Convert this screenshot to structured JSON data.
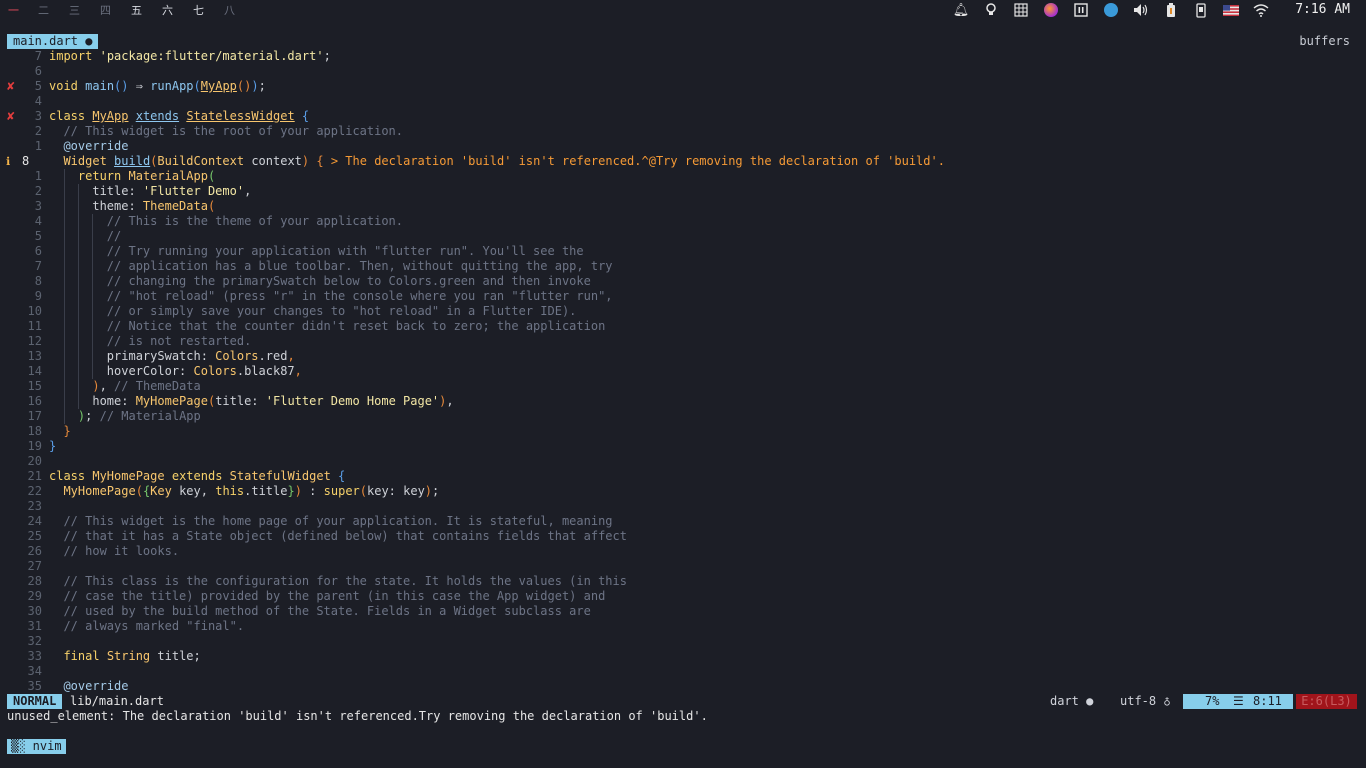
{
  "topbar": {
    "workspaces": [
      "一",
      "二",
      "三",
      "四",
      "五",
      "六",
      "七",
      "八"
    ],
    "clock": "7:16 AM",
    "tray_icons": [
      "bell-icon",
      "lightbulb-icon",
      "grid-icon",
      "firefox-icon",
      "pause-icon",
      "telegram-icon",
      "volume-icon",
      "battery-icon",
      "phone-icon",
      "us-flag-icon",
      "wifi-icon"
    ]
  },
  "tabline": {
    "active_tab": "main.dart ●",
    "right_label": "buffers"
  },
  "editor": {
    "lines": [
      {
        "ln": "7",
        "sign": "",
        "html": "<span class='kw'>import</span> <span class='str'>'package:flutter/material.dart'</span>;"
      },
      {
        "ln": "6",
        "sign": "",
        "html": ""
      },
      {
        "ln": "5",
        "sign": "err",
        "html": "<span class='kw'>void</span> <span class='fn'>main</span><span class='par1'>()</span> ⇒ <span class='fn'>runApp</span><span class='par1'>(</span><span class='cls ul'>MyApp</span><span class='par2'>()</span><span class='par1'>)</span>;"
      },
      {
        "ln": "4",
        "sign": "",
        "html": ""
      },
      {
        "ln": "3",
        "sign": "err",
        "html": "<span class='kw'>class</span> <span class='cls ul'>MyApp</span> <span class='fn ul'>xtends</span> <span class='cls ul'>StatelessWidget</span> <span class='par1'>{</span>"
      },
      {
        "ln": "2",
        "sign": "",
        "html": "  <span class='cmt'>// This widget is the root of your application.</span>"
      },
      {
        "ln": "1",
        "sign": "",
        "html": "  <span class='ann'>@override</span>"
      },
      {
        "ln": "8",
        "sign": "info",
        "cur": true,
        "html": "  <span class='cls'>Widget</span> <span class='fn ul'>build</span><span class='par2'>(</span><span class='cls'>BuildContext</span> context<span class='par2'>)</span> <span class='par2'>{</span> <span class='warn'>&gt; The declaration 'build' isn't referenced.^@Try removing the declaration of 'build'.</span>"
      },
      {
        "ln": "1",
        "sign": "",
        "html": "    <span class='kw'>return</span> <span class='cls'>MaterialApp</span><span class='par3'>(</span>"
      },
      {
        "ln": "2",
        "sign": "",
        "html": "      title: <span class='str'>'Flutter Demo'</span>,"
      },
      {
        "ln": "3",
        "sign": "",
        "html": "      theme: <span class='cls'>ThemeData</span><span class='par2'>(</span>"
      },
      {
        "ln": "4",
        "sign": "",
        "html": "        <span class='cmt'>// This is the theme of your application.</span>"
      },
      {
        "ln": "5",
        "sign": "",
        "html": "        <span class='cmt'>//</span>"
      },
      {
        "ln": "6",
        "sign": "",
        "html": "        <span class='cmt'>// Try running your application with \"flutter run\". You'll see the</span>"
      },
      {
        "ln": "7",
        "sign": "",
        "html": "        <span class='cmt'>// application has a blue toolbar. Then, without quitting the app, try</span>"
      },
      {
        "ln": "8",
        "sign": "",
        "html": "        <span class='cmt'>// changing the primarySwatch below to Colors.green and then invoke</span>"
      },
      {
        "ln": "9",
        "sign": "",
        "html": "        <span class='cmt'>// \"hot reload\" (press \"r\" in the console where you ran \"flutter run\",</span>"
      },
      {
        "ln": "10",
        "sign": "",
        "html": "        <span class='cmt'>// or simply save your changes to \"hot reload\" in a Flutter IDE).</span>"
      },
      {
        "ln": "11",
        "sign": "",
        "html": "        <span class='cmt'>// Notice that the counter didn't reset back to zero; the application</span>"
      },
      {
        "ln": "12",
        "sign": "",
        "html": "        <span class='cmt'>// is not restarted.</span>"
      },
      {
        "ln": "13",
        "sign": "",
        "html": "        primarySwatch: <span class='cls'>Colors</span>.red<span class='par2'>,</span>"
      },
      {
        "ln": "14",
        "sign": "",
        "html": "        hoverColor: <span class='cls'>Colors</span>.black87<span class='par2'>,</span>"
      },
      {
        "ln": "15",
        "sign": "",
        "html": "      <span class='par2'>)</span>, <span class='cmt'>// ThemeData</span>"
      },
      {
        "ln": "16",
        "sign": "",
        "html": "      home: <span class='cls'>MyHomePage</span><span class='par2'>(</span>title: <span class='str'>'Flutter Demo Home Page'</span><span class='par2'>)</span>,"
      },
      {
        "ln": "17",
        "sign": "",
        "html": "    <span class='par3'>)</span>; <span class='cmt'>// MaterialApp</span>"
      },
      {
        "ln": "18",
        "sign": "",
        "html": "  <span class='par2'>}</span>"
      },
      {
        "ln": "19",
        "sign": "",
        "html": "<span class='par1'>}</span>"
      },
      {
        "ln": "20",
        "sign": "",
        "html": ""
      },
      {
        "ln": "21",
        "sign": "",
        "html": "<span class='kw'>class</span> <span class='cls'>MyHomePage</span> <span class='kw'>extends</span> <span class='cls'>StatefulWidget</span> <span class='par1'>{</span>"
      },
      {
        "ln": "22",
        "sign": "",
        "html": "  <span class='cls'>MyHomePage</span><span class='par2'>(</span><span class='par3'>{</span><span class='cls'>Key</span> key, <span class='kw'>this</span>.title<span class='par3'>}</span><span class='par2'>)</span> : <span class='kw'>super</span><span class='par2'>(</span>key: key<span class='par2'>)</span>;"
      },
      {
        "ln": "23",
        "sign": "",
        "html": ""
      },
      {
        "ln": "24",
        "sign": "",
        "html": "  <span class='cmt'>// This widget is the home page of your application. It is stateful, meaning</span>"
      },
      {
        "ln": "25",
        "sign": "",
        "html": "  <span class='cmt'>// that it has a State object (defined below) that contains fields that affect</span>"
      },
      {
        "ln": "26",
        "sign": "",
        "html": "  <span class='cmt'>// how it looks.</span>"
      },
      {
        "ln": "27",
        "sign": "",
        "html": ""
      },
      {
        "ln": "28",
        "sign": "",
        "html": "  <span class='cmt'>// This class is the configuration for the state. It holds the values (in this</span>"
      },
      {
        "ln": "29",
        "sign": "",
        "html": "  <span class='cmt'>// case the title) provided by the parent (in this case the App widget) and</span>"
      },
      {
        "ln": "30",
        "sign": "",
        "html": "  <span class='cmt'>// used by the build method of the State. Fields in a Widget subclass are</span>"
      },
      {
        "ln": "31",
        "sign": "",
        "html": "  <span class='cmt'>// always marked \"final\".</span>"
      },
      {
        "ln": "32",
        "sign": "",
        "html": ""
      },
      {
        "ln": "33",
        "sign": "",
        "html": "  <span class='kw'>final</span> <span class='cls'>String</span> title;"
      },
      {
        "ln": "34",
        "sign": "",
        "html": ""
      },
      {
        "ln": "35",
        "sign": "",
        "html": "  <span class='ann'>@override</span>"
      }
    ]
  },
  "statusline": {
    "mode": "NORMAL",
    "file": "lib/main.dart",
    "filetype": "dart ●",
    "encoding": "utf-8 ♁",
    "percent": "7%",
    "position_icon": "☰",
    "position": "8:11",
    "diagnostics": "E:6(L3)"
  },
  "message": "unused_element: The declaration 'build' isn't referenced.Try removing the declaration of 'build'.",
  "tmux": {
    "window": "▒░ nvim"
  },
  "colors": {
    "background": "#1c1e26",
    "accent": "#87ceeb",
    "error": "#a1141b",
    "keyword": "#f7d26a",
    "comment": "#6d7486"
  }
}
